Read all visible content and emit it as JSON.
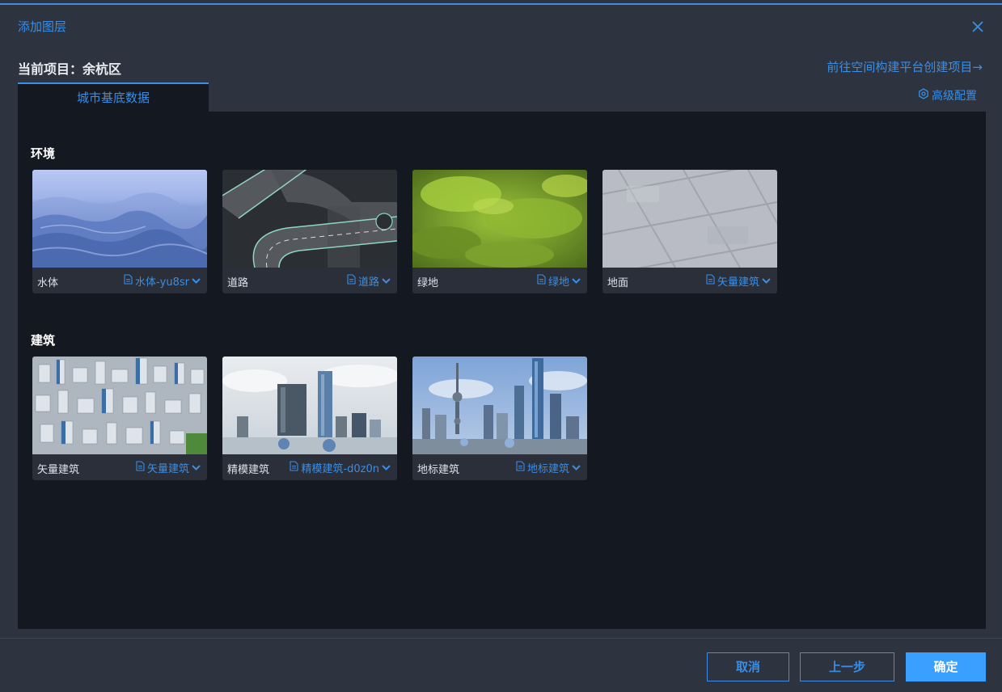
{
  "dialog": {
    "title": "添加图层",
    "project_label": "当前项目：余杭区",
    "goto_link": "前往空间构建平台创建项目→",
    "tab": "城市基底数据",
    "advanced": "高级配置"
  },
  "sections": [
    {
      "title": "环境",
      "cards": [
        {
          "name": "水体",
          "dataset": "水体-yu8sr"
        },
        {
          "name": "道路",
          "dataset": "道路"
        },
        {
          "name": "绿地",
          "dataset": "绿地"
        },
        {
          "name": "地面",
          "dataset": "矢量建筑"
        }
      ]
    },
    {
      "title": "建筑",
      "cards": [
        {
          "name": "矢量建筑",
          "dataset": "矢量建筑"
        },
        {
          "name": "精模建筑",
          "dataset": "精模建筑-d0z0n"
        },
        {
          "name": "地标建筑",
          "dataset": "地标建筑"
        }
      ]
    }
  ],
  "footer": {
    "cancel": "取消",
    "prev": "上一步",
    "confirm": "确定"
  },
  "icons": {
    "close": "close-icon",
    "settings": "settings-icon",
    "file": "file-icon",
    "dropdown": "chevron-down-icon"
  },
  "colors": {
    "accent": "#3a8ee6",
    "primary_button": "#3aa0ff",
    "panel_bg": "#141820",
    "dialog_bg": "#2e343f"
  }
}
